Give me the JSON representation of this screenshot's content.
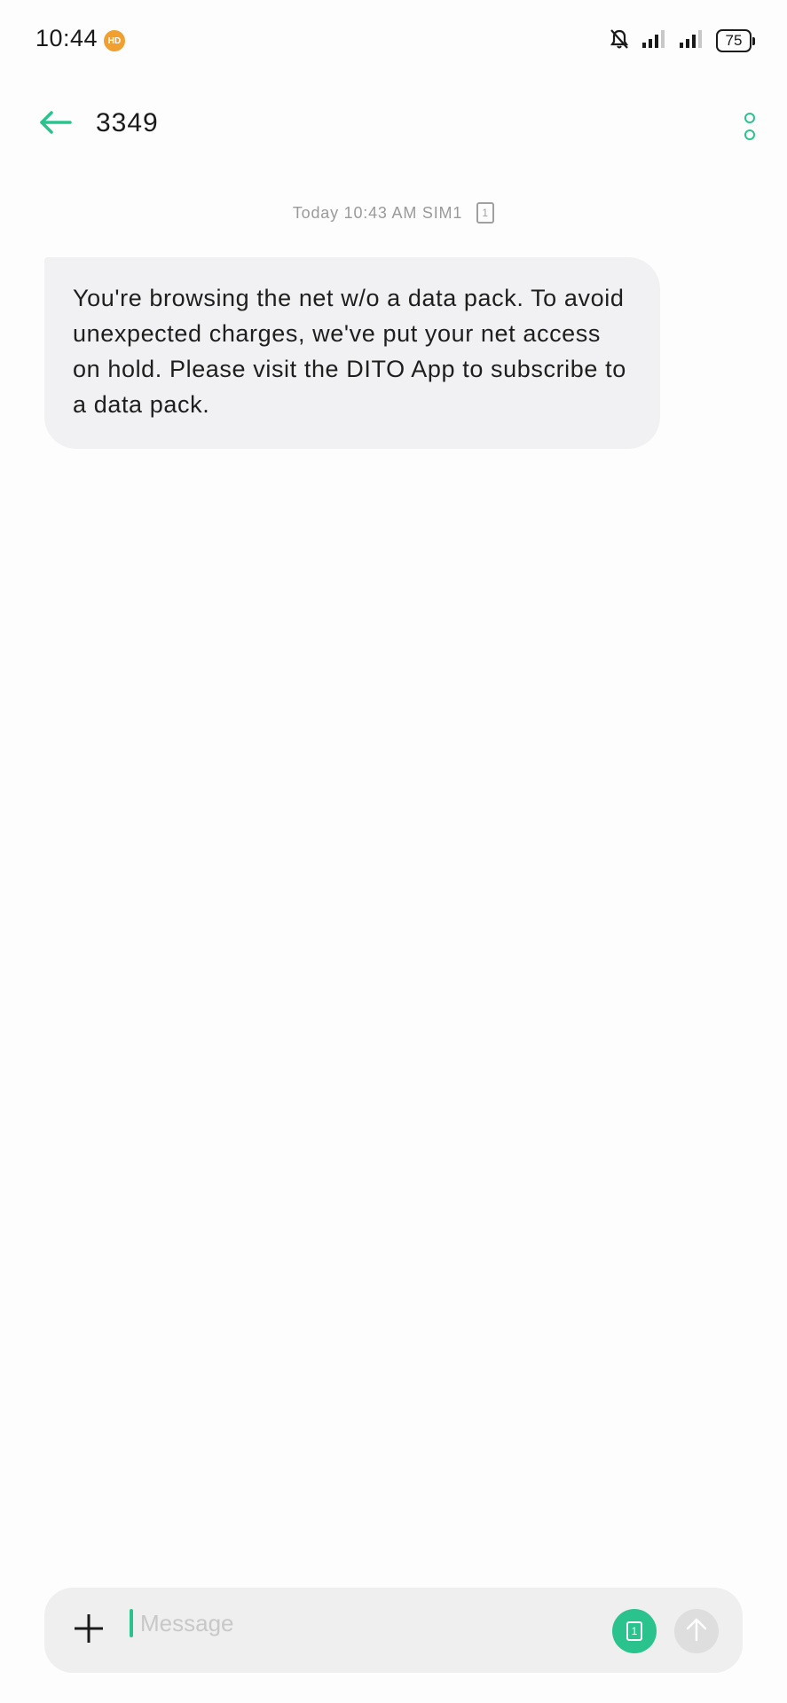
{
  "status_bar": {
    "time": "10:44",
    "app_icon_glyph": "HD",
    "battery_level": "75",
    "icons": [
      "app-notification-icon",
      "mute-bell-icon",
      "signal-icon",
      "signal-icon",
      "battery-icon"
    ]
  },
  "header": {
    "back_icon": "arrow-left-icon",
    "title": "3349",
    "more_icon": "more-vertical-icon"
  },
  "conversation": {
    "timestamp": "Today 10:43 AM SIM1",
    "sim_badge": "1",
    "messages": [
      {
        "direction": "incoming",
        "text": "You're browsing the net w/o a data pack. To avoid unexpected charges, we've put your net access on hold. Please visit the DITO App to subscribe to a data pack."
      }
    ]
  },
  "composer": {
    "attach_icon": "plus-icon",
    "placeholder": "Message",
    "value": "",
    "sim_button_label": "1",
    "send_icon": "arrow-up-icon"
  },
  "colors": {
    "accent": "#2bc38d",
    "background": "#fdfdfd",
    "bubble": "#f1f1f3",
    "composer": "#efefef",
    "muted_text": "#9a9a9a"
  }
}
